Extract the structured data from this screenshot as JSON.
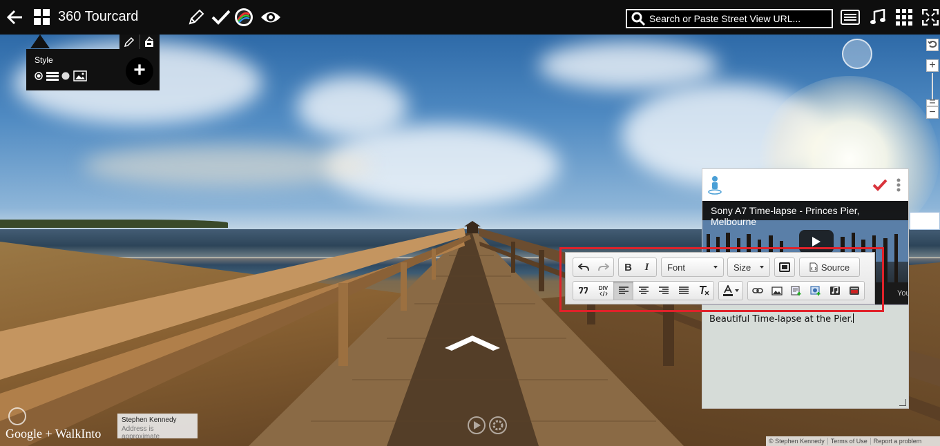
{
  "app": {
    "title": "360 Tourcard"
  },
  "search": {
    "placeholder": "Search or Paste Street View URL..."
  },
  "style_panel": {
    "label": "Style",
    "add_label": "+"
  },
  "card": {
    "video_title": "Sony A7 Time-lapse - Princes Pier, Melbourne",
    "youtube_label": "You",
    "editor_text": "Beautiful Time-lapse at the Pier."
  },
  "toolbar": {
    "font_label": "Font",
    "size_label": "Size",
    "source_label": "Source",
    "bold_label": "B",
    "italic_label": "I",
    "div_label": "DIV"
  },
  "brand": {
    "text": "Google + WalkInto"
  },
  "address": {
    "name": "Stephen Kennedy",
    "note": "Address is approximate"
  },
  "footer": {
    "copyright": "© Stephen Kennedy",
    "terms": "Terms of Use",
    "report": "Report a problem"
  },
  "colors": {
    "accent_red": "#e0222a",
    "check_red": "#d9343c",
    "person_blue": "#4a9fd6"
  }
}
